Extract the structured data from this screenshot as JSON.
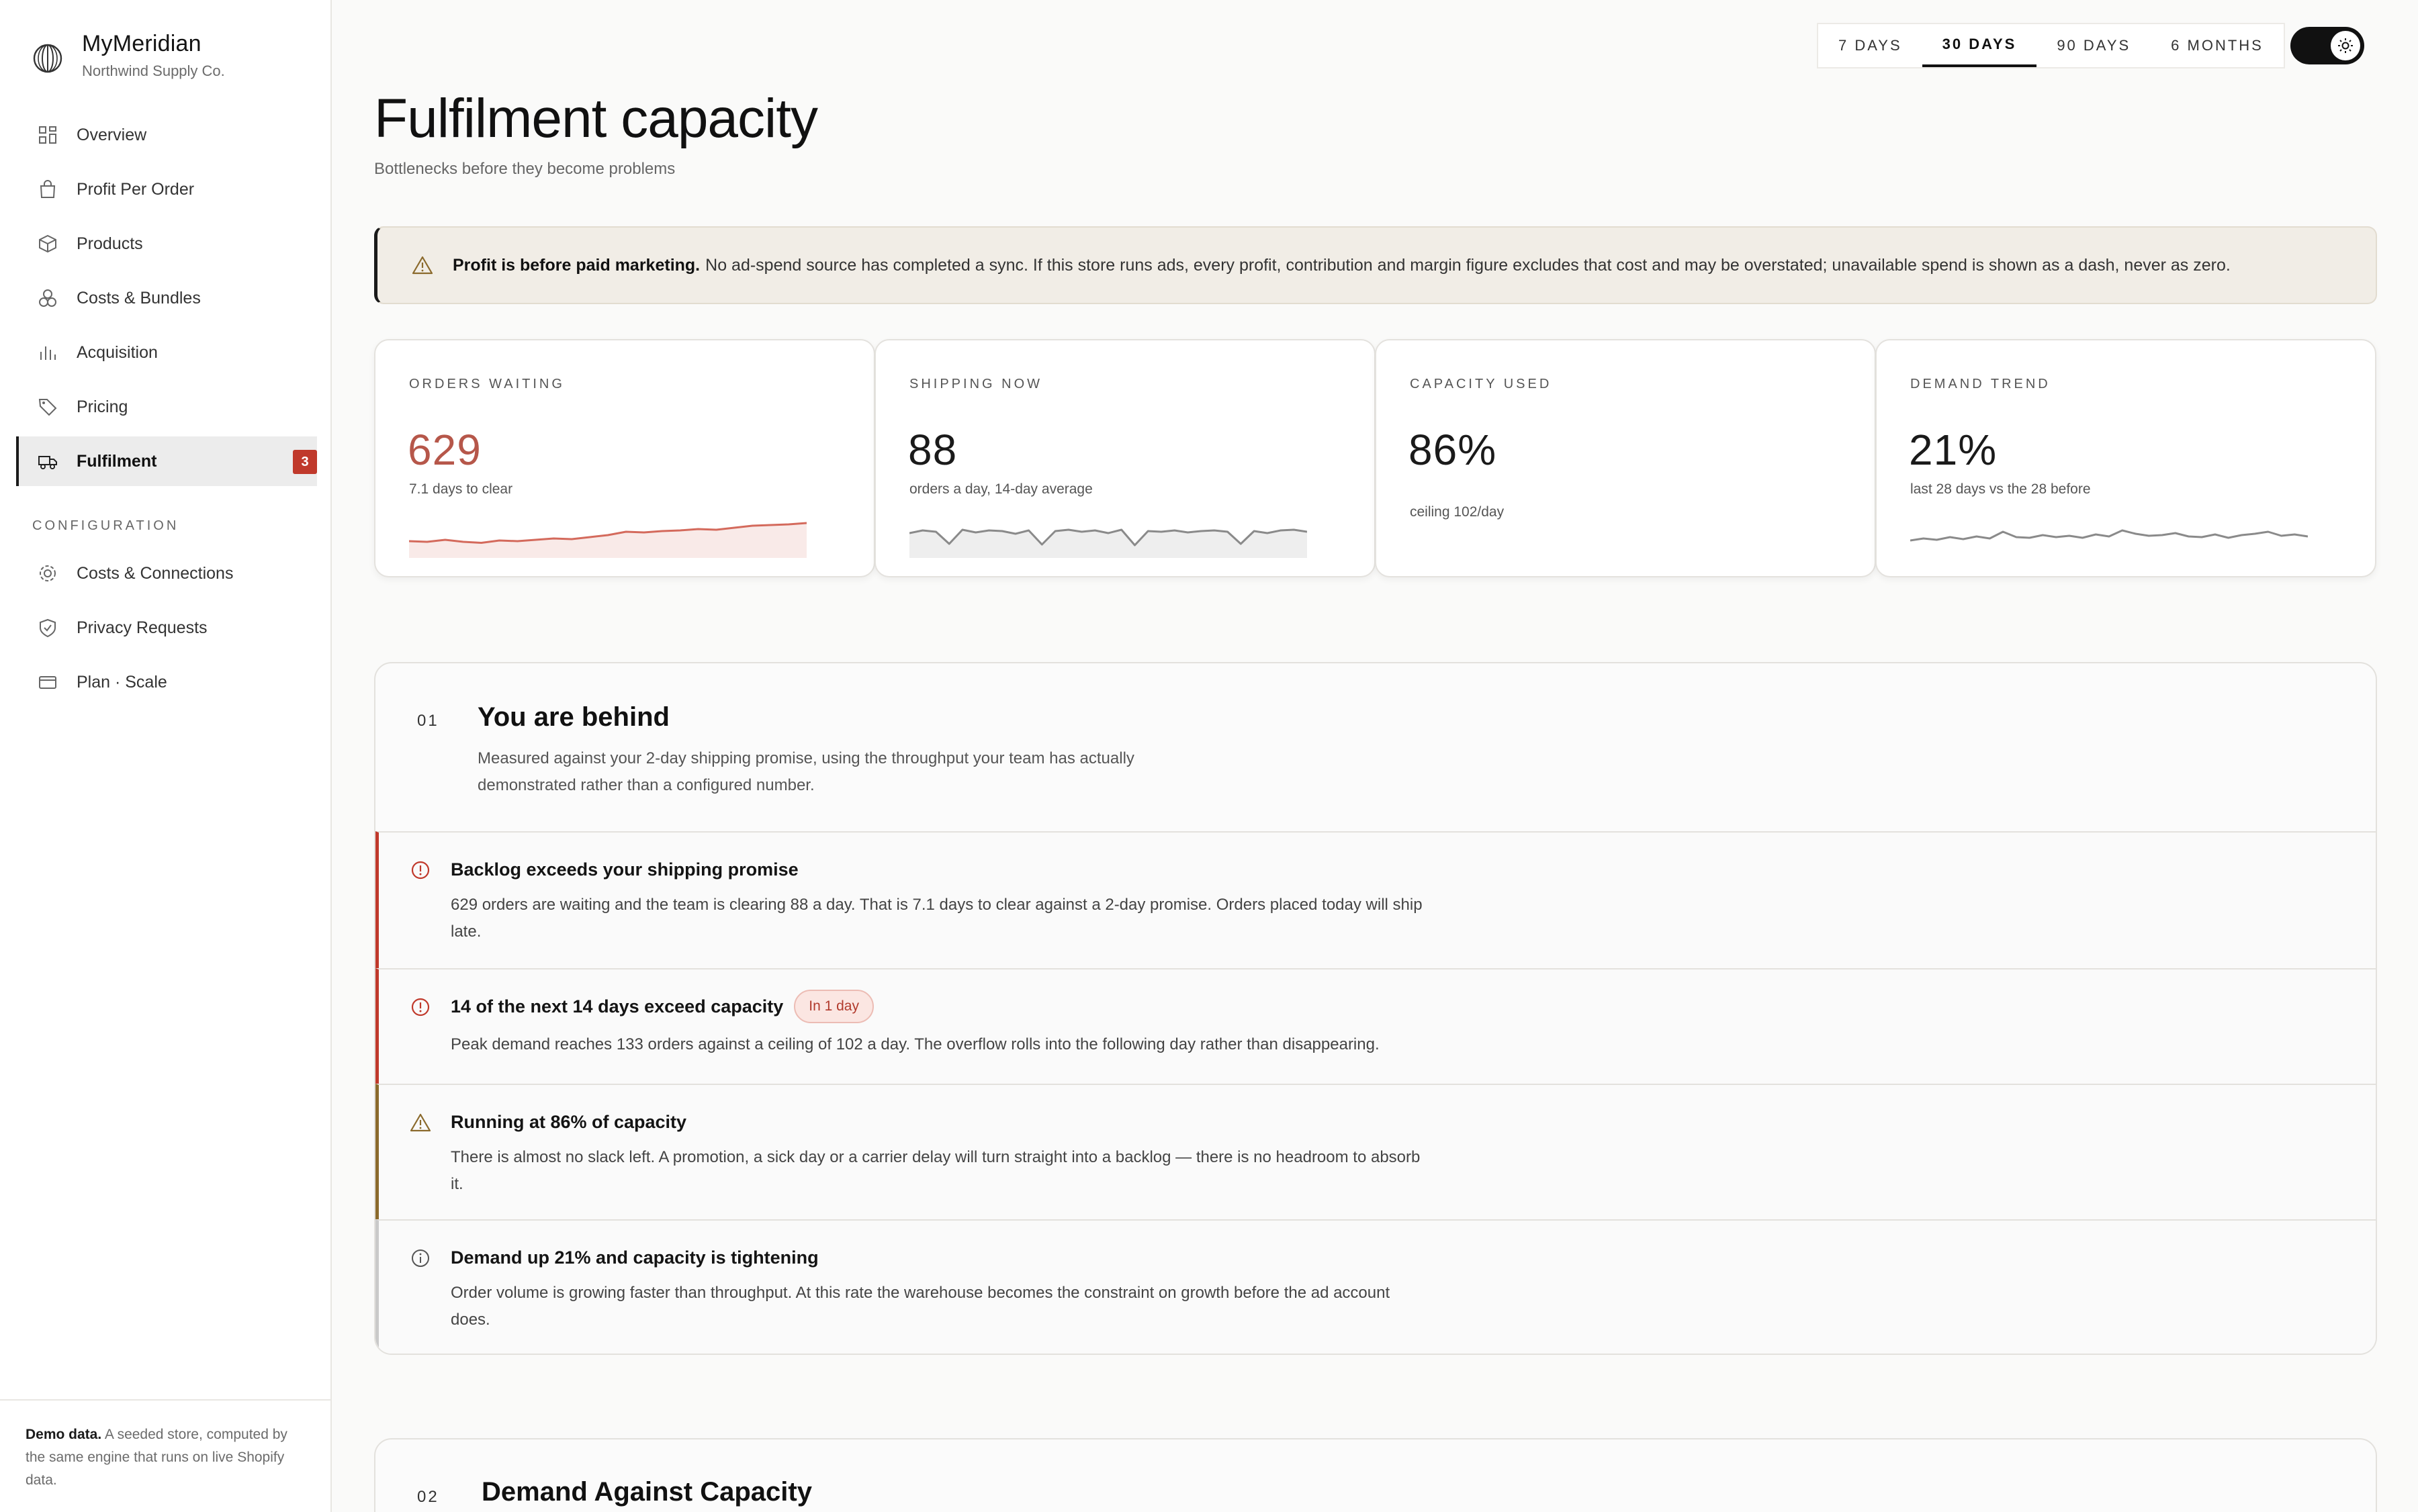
{
  "brand": {
    "name": "MyMeridian",
    "company": "Northwind Supply Co."
  },
  "nav": {
    "items": [
      {
        "label": "Overview",
        "icon": "grid-icon"
      },
      {
        "label": "Profit Per Order",
        "icon": "bag-icon"
      },
      {
        "label": "Products",
        "icon": "box-icon"
      },
      {
        "label": "Costs & Bundles",
        "icon": "coins-icon"
      },
      {
        "label": "Acquisition",
        "icon": "bar-chart-icon"
      },
      {
        "label": "Pricing",
        "icon": "tag-icon"
      },
      {
        "label": "Fulfilment",
        "icon": "truck-icon",
        "badge": "3",
        "active": true
      }
    ],
    "config_title": "CONFIGURATION",
    "config_items": [
      {
        "label": "Costs & Connections",
        "icon": "gear-icon"
      },
      {
        "label": "Privacy Requests",
        "icon": "shield-icon"
      },
      {
        "label": "Plan · Scale",
        "icon": "card-icon"
      }
    ]
  },
  "footer": {
    "strong": "Demo data.",
    "text": "A seeded store, computed by the same engine that runs on live Shopify data."
  },
  "range": {
    "tabs": [
      "7 DAYS",
      "30 DAYS",
      "90 DAYS",
      "6 MONTHS"
    ],
    "selected": "30 DAYS"
  },
  "page": {
    "title": "Fulfilment capacity",
    "subtitle": "Bottlenecks before they become problems"
  },
  "banner": {
    "strong": "Profit is before paid marketing.",
    "text": "No ad-spend source has completed a sync. If this store runs ads, every profit, contribution and margin figure excludes that cost and may be overstated; unavailable spend is shown as a dash, never as zero."
  },
  "kpis": [
    {
      "label": "ORDERS WAITING",
      "value": "629",
      "note": "7.1 days to clear",
      "trend": [
        0.38,
        0.36,
        0.42,
        0.36,
        0.33,
        0.4,
        0.38,
        0.42,
        0.46,
        0.44,
        0.5,
        0.56,
        0.66,
        0.64,
        0.68,
        0.7,
        0.74,
        0.72,
        0.78,
        0.84,
        0.86,
        0.88,
        0.92
      ]
    },
    {
      "label": "SHIPPING NOW",
      "value": "88",
      "note": "orders a day, 14-day average",
      "trend": [
        0.62,
        0.7,
        0.66,
        0.3,
        0.72,
        0.64,
        0.7,
        0.68,
        0.6,
        0.7,
        0.28,
        0.68,
        0.72,
        0.66,
        0.7,
        0.62,
        0.72,
        0.26,
        0.68,
        0.66,
        0.7,
        0.64,
        0.68,
        0.7,
        0.66,
        0.3,
        0.68,
        0.62,
        0.7,
        0.72,
        0.66
      ]
    },
    {
      "label": "CAPACITY USED",
      "value": "86%",
      "note": "ceiling 102/day",
      "trend": []
    },
    {
      "label": "DEMAND TREND",
      "value": "21%",
      "note": "last 28 days vs the 28 before",
      "trend": [
        0.4,
        0.46,
        0.42,
        0.5,
        0.44,
        0.52,
        0.46,
        0.66,
        0.5,
        0.48,
        0.56,
        0.5,
        0.54,
        0.48,
        0.58,
        0.52,
        0.7,
        0.6,
        0.54,
        0.56,
        0.62,
        0.52,
        0.5,
        0.58,
        0.48,
        0.56,
        0.6,
        0.66,
        0.54,
        0.58,
        0.52
      ]
    }
  ],
  "section1": {
    "num": "01",
    "title": "You are behind",
    "desc": "Measured against your 2-day shipping promise, using the throughput your team has actually demonstrated rather than a configured number.",
    "issues": [
      {
        "severity": "critical",
        "icon": "alert-circle-icon",
        "title": "Backlog exceeds your shipping promise",
        "text": "629 orders are waiting and the team is clearing 88 a day. That is 7.1 days to clear against a 2-day promise. Orders placed today will ship late."
      },
      {
        "severity": "critical",
        "icon": "alert-circle-icon",
        "title": "14 of the next 14 days exceed capacity",
        "pill": "In 1 day",
        "text": "Peak demand reaches 133 orders against a ceiling of 102 a day. The overflow rolls into the following day rather than disappearing."
      },
      {
        "severity": "warning",
        "icon": "warning-triangle-icon",
        "title": "Running at 86% of capacity",
        "text": "There is almost no slack left. A promotion, a sick day or a carrier delay will turn straight into a backlog — there is no headroom to absorb it."
      },
      {
        "severity": "info",
        "icon": "info-circle-icon",
        "title": "Demand up 21% and capacity is tightening",
        "text": "Order volume is growing faster than throughput. At this rate the warehouse becomes the constraint on growth before the ad account does."
      }
    ]
  },
  "section2": {
    "num": "02",
    "title": "Demand Against Capacity"
  },
  "colors": {
    "critical": "#c0392b",
    "warning": "#8b6a2c",
    "accent": "#b6574a",
    "ink": "#111111"
  }
}
